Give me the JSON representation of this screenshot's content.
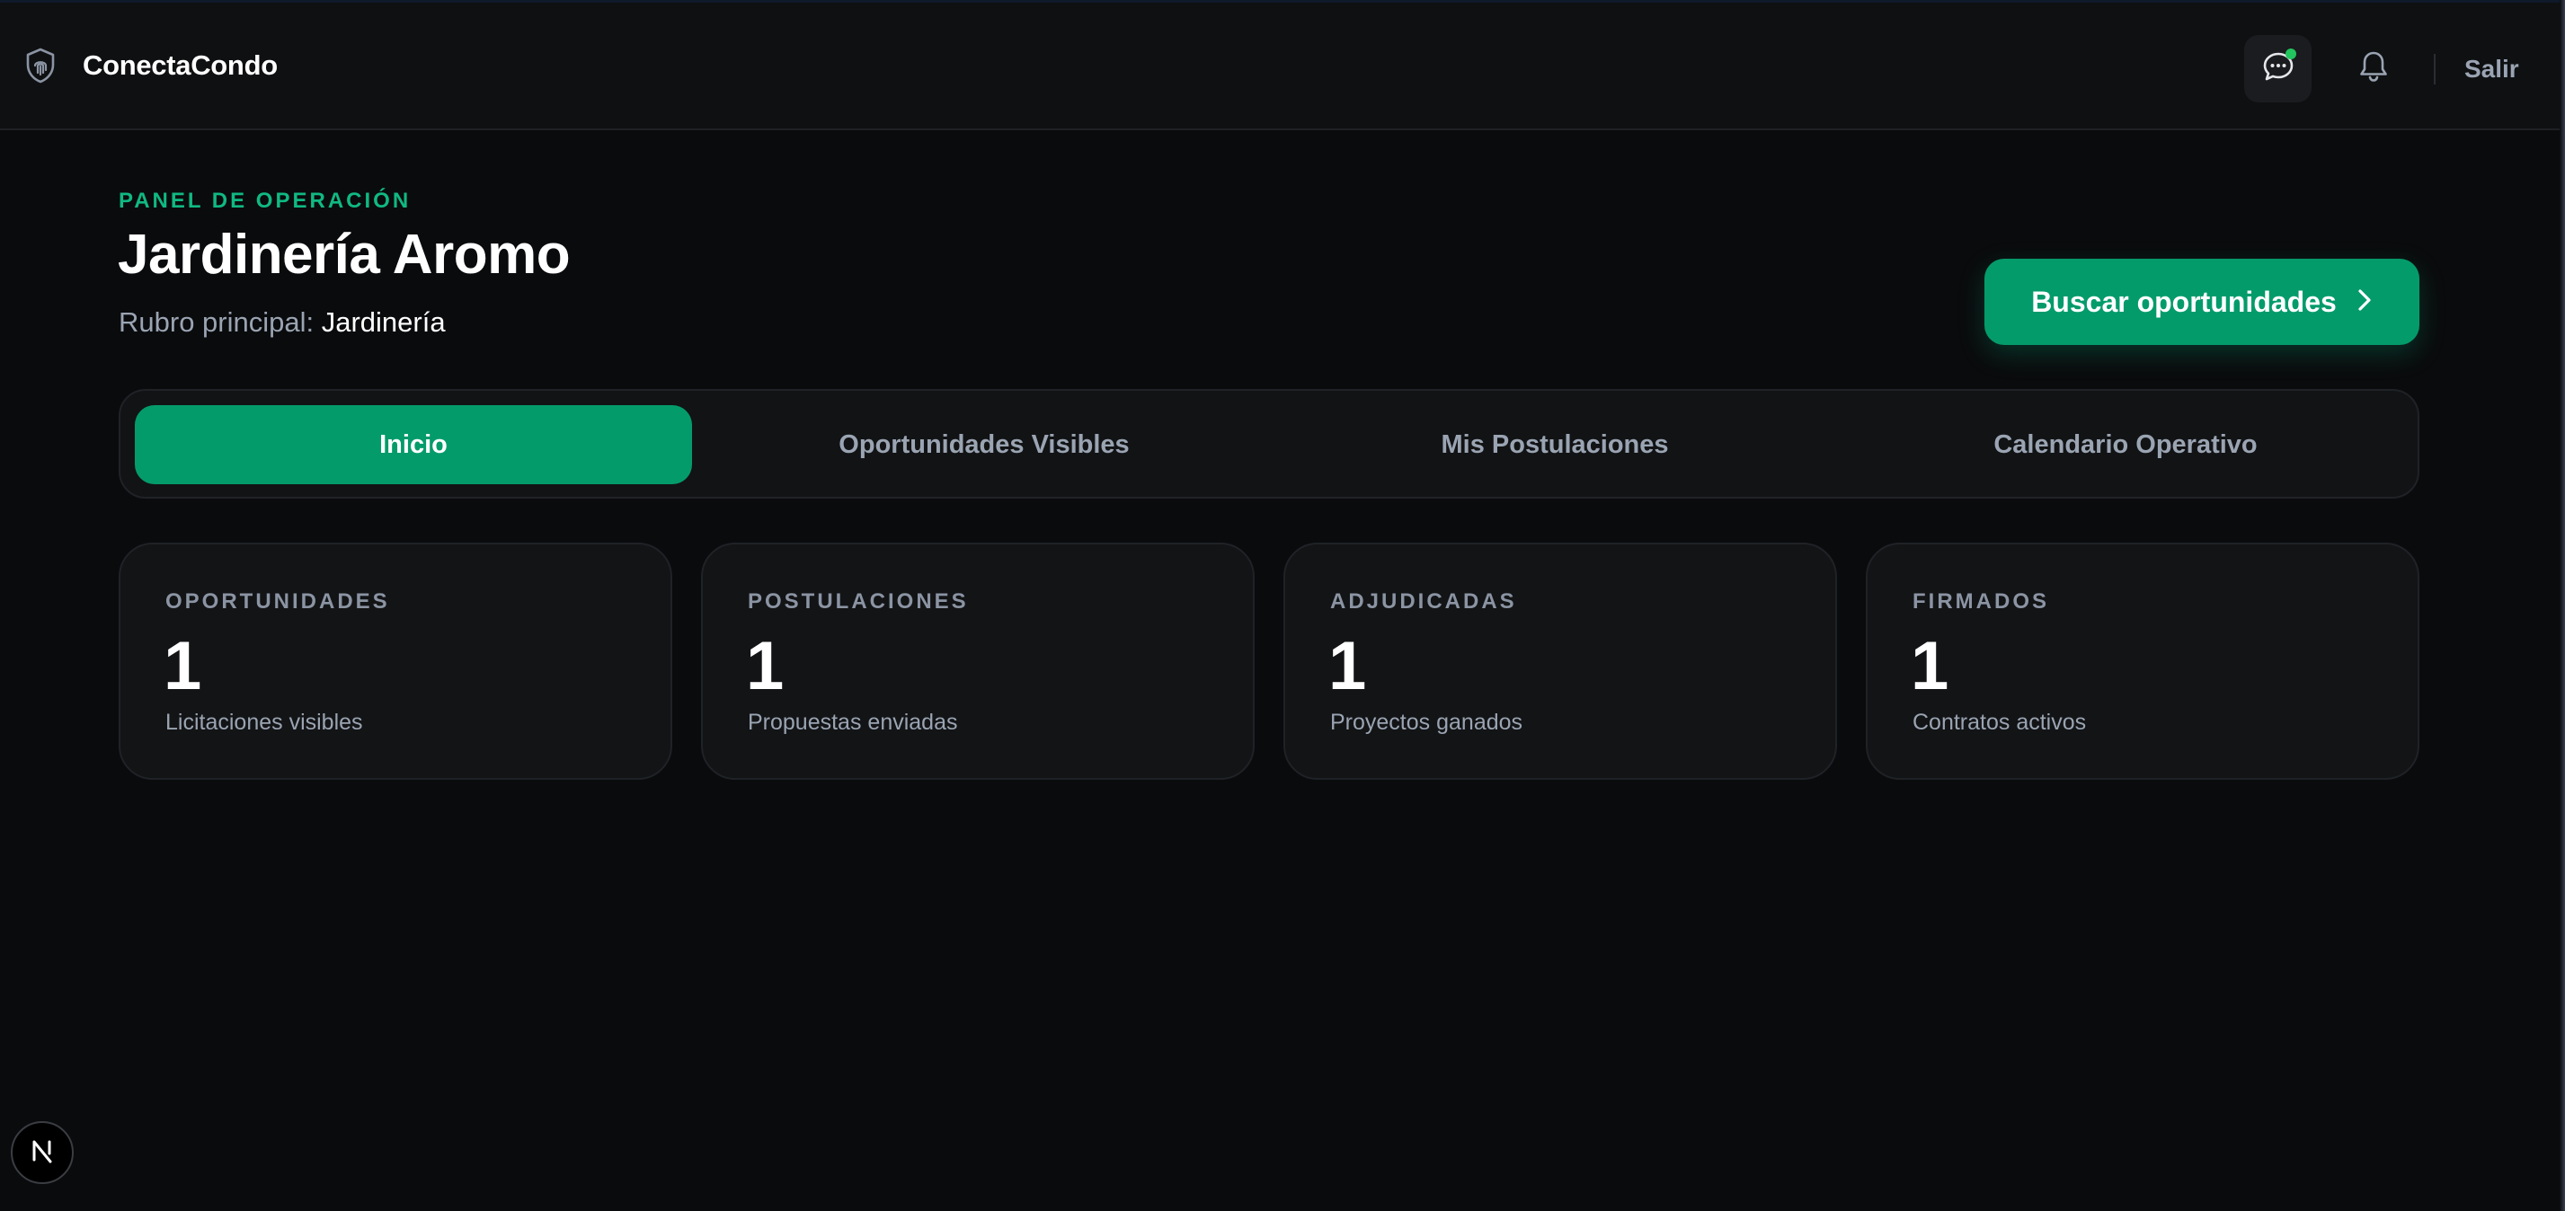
{
  "header": {
    "brand_name": "ConectaCondo",
    "logout_label": "Salir",
    "icons": {
      "brand": "shield-fingerprint-icon",
      "chat": "chat-bubble-icon",
      "notifications": "bell-icon"
    },
    "chat_unread_dot_color": "#22c55e"
  },
  "hero": {
    "eyebrow": "PANEL DE OPERACIÓN",
    "title": "Jardinería Aromo",
    "subtitle_label": "Rubro principal:",
    "subtitle_value": "Jardinería",
    "cta_label": "Buscar oportunidades",
    "cta_icon": "chevron-right-icon"
  },
  "tabs": [
    {
      "label": "Inicio",
      "active": true
    },
    {
      "label": "Oportunidades Visibles",
      "active": false
    },
    {
      "label": "Mis Postulaciones",
      "active": false
    },
    {
      "label": "Calendario Operativo",
      "active": false
    }
  ],
  "stats": [
    {
      "label": "OPORTUNIDADES",
      "value": "1",
      "caption": "Licitaciones visibles"
    },
    {
      "label": "POSTULACIONES",
      "value": "1",
      "caption": "Propuestas enviadas"
    },
    {
      "label": "ADJUDICADAS",
      "value": "1",
      "caption": "Proyectos ganados"
    },
    {
      "label": "FIRMADOS",
      "value": "1",
      "caption": "Contratos activos"
    }
  ],
  "badge": {
    "label": "N"
  },
  "colors": {
    "accent": "#049b6b",
    "accent_text": "#10b981",
    "background": "#0a0b0d",
    "surface": "#131416",
    "muted_text": "#9aa4b2"
  }
}
